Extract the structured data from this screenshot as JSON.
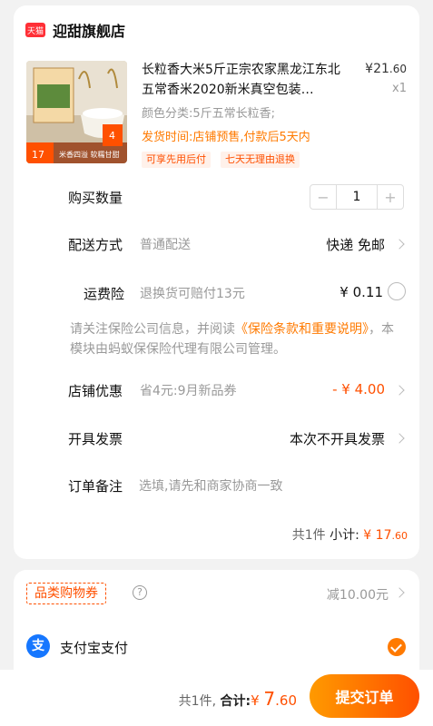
{
  "store": {
    "badge": "天猫",
    "name": "迎甜旗舰店"
  },
  "product": {
    "title": "长粒香大米5斤正宗农家黑龙江东北五常香米2020新米真空包装…",
    "price_symbol": "¥",
    "price_int": "21",
    "price_dec": ".60",
    "qty": "x1",
    "spec": "颜色分类:5斤五常长粒香;",
    "shipping_notice": "发货时间:店铺预售,付款后5天内",
    "tags": [
      "可享先用后付",
      "七天无理由退换"
    ],
    "image_texts": {
      "badge_price": "17",
      "badge_num": "4",
      "bottom_text": "米香四溢 软糯甘甜"
    }
  },
  "quantity": {
    "label": "购买数量",
    "minus": "−",
    "value": "1",
    "plus": "+"
  },
  "delivery": {
    "label": "配送方式",
    "sub": "普通配送",
    "right": "快递 免邮"
  },
  "insurance": {
    "label": "运费险",
    "sub": "退换货可赔付13元",
    "price": "¥ 0.11"
  },
  "notice": {
    "prefix": "请关注保险公司信息，并阅读",
    "link": "《保险条款和重要说明》",
    "suffix": "，本模块由蚂蚁保保险代理有限公司管理。"
  },
  "store_discount": {
    "label": "店铺优惠",
    "sub": "省4元:9月新品券",
    "value": "- ¥ 4.00"
  },
  "invoice": {
    "label": "开具发票",
    "value": "本次不开具发票"
  },
  "remark": {
    "label": "订单备注",
    "placeholder": "选填,请先和商家协商一致"
  },
  "summary": {
    "count": "共1件",
    "subtotal_label": "小计:",
    "symbol": "¥",
    "int": "17",
    "dec": ".60"
  },
  "coupon": {
    "label": "品类购物券",
    "help": "?",
    "value": "减10.00元"
  },
  "payment": {
    "icon": "支",
    "label": "支付宝支付"
  },
  "bottom": {
    "count": "共1件,",
    "total_label": "合计:",
    "symbol": "¥",
    "int": "7",
    "dec": ".60",
    "submit": "提交订单"
  },
  "colors": {
    "accent": "#ff5000",
    "orange": "#ff7a00",
    "tmall": "#ff2f36",
    "alipay": "#1677ff"
  }
}
